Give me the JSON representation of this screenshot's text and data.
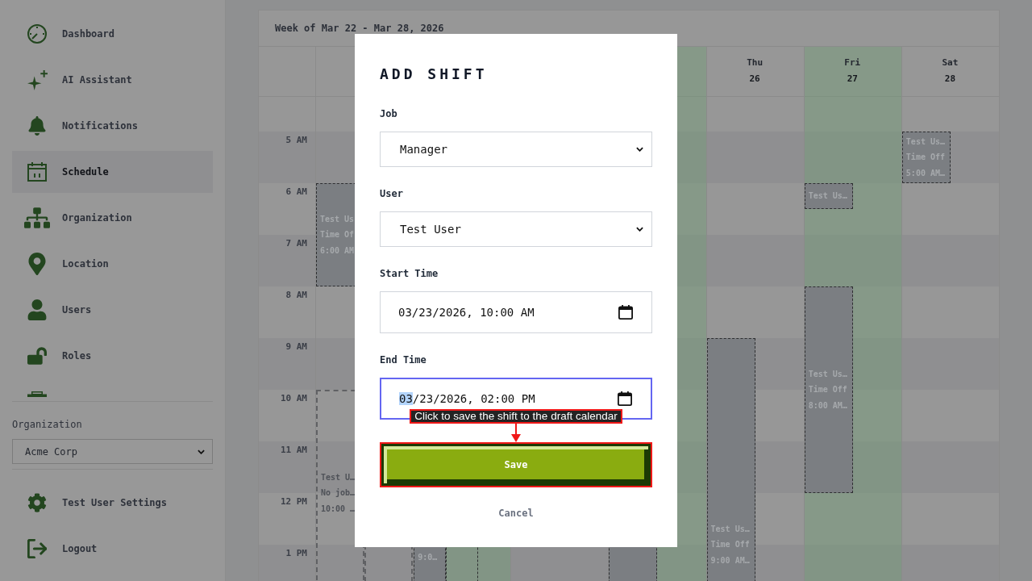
{
  "sidebar": {
    "nav_items": [
      {
        "label": "Dashboard",
        "selected": false
      },
      {
        "label": "AI Assistant",
        "selected": false
      },
      {
        "label": "Notifications",
        "selected": false
      },
      {
        "label": "Schedule",
        "selected": true
      },
      {
        "label": "Organization",
        "selected": false
      },
      {
        "label": "Location",
        "selected": false
      },
      {
        "label": "Users",
        "selected": false
      },
      {
        "label": "Roles",
        "selected": false
      }
    ],
    "organization_select": {
      "label": "Organization",
      "value": "Acme Corp"
    },
    "footer_items": [
      {
        "label": "Test User Settings"
      },
      {
        "label": "Logout"
      }
    ]
  },
  "calendar": {
    "title": "Week of Mar 22 - Mar 28, 2026",
    "hours": [
      "5 AM",
      "6 AM",
      "7 AM",
      "8 AM",
      "9 AM",
      "10 AM",
      "11 AM",
      "12 PM",
      "1 PM"
    ],
    "days": [
      {
        "highlighted": false,
        "shifts": [
          {
            "kind": "time_off",
            "lines": [
              "Test Us",
              "Time Of",
              "6:00 AM"
            ]
          },
          {
            "kind": "draft",
            "lines": [
              "Test U…",
              "No job…",
              "10:00 …"
            ]
          },
          {
            "kind": "draft"
          }
        ]
      },
      {
        "highlighted": true,
        "shifts": [
          {
            "kind": "time_off",
            "lines": [
              "9:0…"
            ]
          },
          {
            "kind": "outline"
          }
        ]
      },
      {
        "highlighted": false
      },
      {
        "highlighted": true,
        "shifts": [
          {
            "kind": "time_off"
          }
        ]
      },
      {
        "name": "Thu",
        "date": "26",
        "highlighted": false,
        "shifts": [
          {
            "kind": "time_off",
            "lines": [
              "Test Us…",
              "Time Off",
              "9:00 AM…"
            ]
          }
        ]
      },
      {
        "name": "Fri",
        "date": "27",
        "highlighted": true,
        "shifts": [
          {
            "kind": "time_off",
            "lines": [
              "Test Us…"
            ]
          },
          {
            "kind": "time_off",
            "lines": [
              "Test Us…",
              "Time Off",
              "8:00 AM…"
            ]
          }
        ]
      },
      {
        "name": "Sat",
        "date": "28",
        "highlighted": false,
        "shifts": [
          {
            "kind": "time_off",
            "lines": [
              "Test Us…",
              "Time Off",
              "5:00 AM…"
            ]
          }
        ]
      }
    ]
  },
  "dialog": {
    "title": "ADD SHIFT",
    "fields": [
      {
        "kind": "select",
        "label": "Job",
        "value": "Manager",
        "focused": false
      },
      {
        "kind": "select",
        "label": "User",
        "value": "Test User",
        "focused": false
      },
      {
        "kind": "datetime",
        "label": "Start Time",
        "segments": [
          {
            "text": "03/23/2026, 10:00 AM",
            "selected": false
          }
        ],
        "focused": false
      },
      {
        "kind": "datetime",
        "label": "End Time",
        "segments": [
          {
            "text": "03",
            "selected": true
          },
          {
            "text": "/23/2026, 02:00 PM",
            "selected": false
          }
        ],
        "focused": true
      }
    ],
    "save_button": {
      "label": "Save",
      "highlighted": true
    },
    "cancel": {
      "label": "Cancel"
    },
    "annotation": {
      "text": "Click to save the shift to the draft calendar"
    }
  }
}
